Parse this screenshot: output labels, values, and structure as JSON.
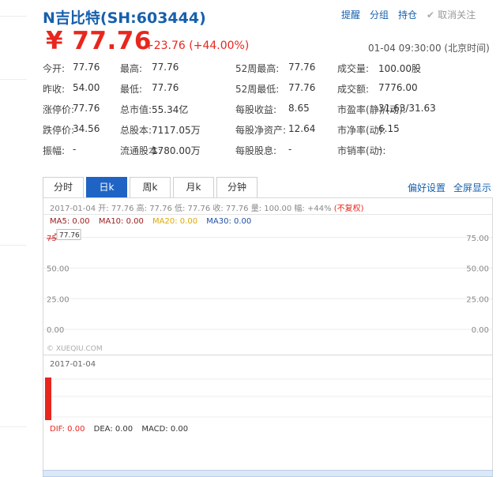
{
  "header": {
    "title": "N吉比特(SH:603444)",
    "actions": {
      "alert": "提醒",
      "group": "分组",
      "hold": "持仓",
      "unfollow": "取消关注"
    },
    "price": "¥ 77.76",
    "change": "+23.76  (+44.00%)",
    "timestamp": "01-04 09:30:00 (北京时间)"
  },
  "stats": [
    {
      "label": "今开:",
      "value": "77.76"
    },
    {
      "label": "最高:",
      "value": "77.76"
    },
    {
      "label": "52周最高:",
      "value": "77.76"
    },
    {
      "label": "成交量:",
      "value": "100.00股"
    },
    {
      "label": "昨收:",
      "value": "54.00"
    },
    {
      "label": "最低:",
      "value": "77.76"
    },
    {
      "label": "52周最低:",
      "value": "77.76"
    },
    {
      "label": "成交额:",
      "value": "7776.00"
    },
    {
      "label": "涨停价:",
      "value": "77.76"
    },
    {
      "label": "总市值:",
      "value": "55.34亿"
    },
    {
      "label": "每股收益:",
      "value": "8.65"
    },
    {
      "label": "市盈率(静)/(动):",
      "value": "31.63/31.63"
    },
    {
      "label": "跌停价:",
      "value": "34.56"
    },
    {
      "label": "总股本:",
      "value": "7117.05万"
    },
    {
      "label": "每股净资产:",
      "value": "12.64"
    },
    {
      "label": "市净率(动):",
      "value": "6.15"
    },
    {
      "label": "振幅:",
      "value": "-"
    },
    {
      "label": "流通股本:",
      "value": "1780.00万"
    },
    {
      "label": "每股股息:",
      "value": "-"
    },
    {
      "label": "市销率(动):",
      "value": "-"
    }
  ],
  "tabs": [
    "分时",
    "日k",
    "周k",
    "月k",
    "分钟"
  ],
  "active_tab": "日k",
  "tab_actions": {
    "prefs": "偏好设置",
    "fullscreen": "全屏显示"
  },
  "chart": {
    "info": "2017-01-04 开: 77.76 高: 77.76 低: 77.76 收: 77.76 量: 100.00 幅: +44%",
    "adjust": "(不复权)",
    "ma": {
      "ma5": "MA5: 0.00",
      "ma10": "MA10: 0.00",
      "ma20": "MA20: 0.00",
      "ma30": "MA30: 0.00"
    },
    "watermark": "© XUEQIU.COM",
    "marker_label": "77.76",
    "top_tick_left": "75"
  },
  "colors": {
    "up": "#e8261e",
    "accent": "#1760ad",
    "tab_active": "#1f64c4"
  },
  "chart_data": {
    "type": "bar",
    "categories": [
      "2017-01-04"
    ],
    "open": [
      77.76
    ],
    "high": [
      77.76
    ],
    "low": [
      77.76
    ],
    "close": [
      77.76
    ],
    "volume": [
      100.0
    ],
    "yticks": [
      "75.00",
      "50.00",
      "25.00",
      "0.00"
    ],
    "ylim": [
      0,
      80
    ]
  },
  "sub_chart": {
    "date": "2017-01-04",
    "macd": {
      "dif": "DIF: 0.00",
      "dea": "DEA: 0.00",
      "macd": "MACD: 0.00"
    }
  }
}
